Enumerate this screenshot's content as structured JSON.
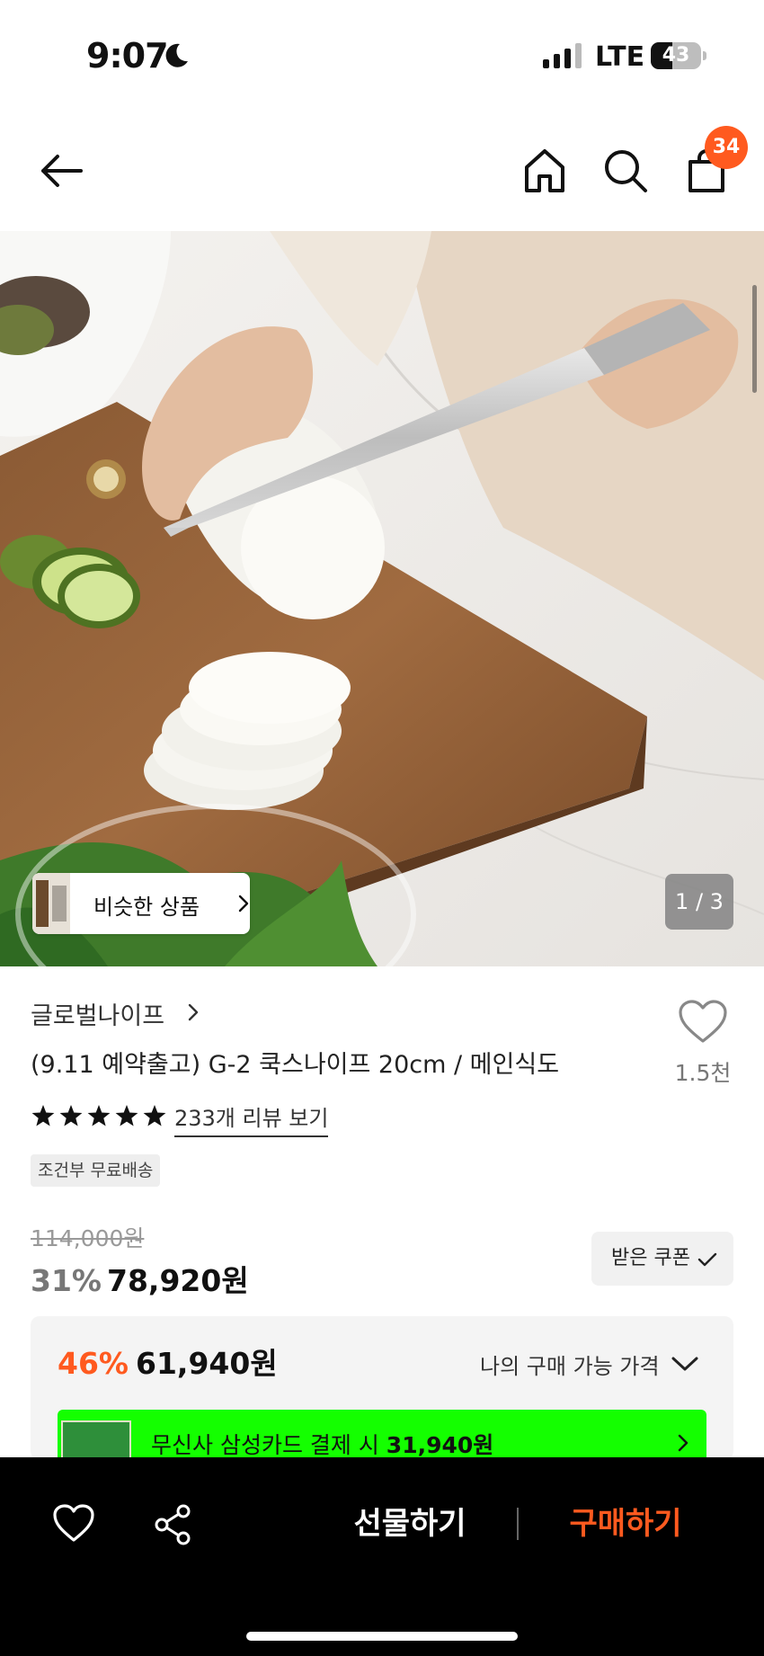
{
  "status_bar": {
    "time": "9:07",
    "network": "LTE",
    "battery": "43",
    "battery_level": 0.43
  },
  "nav": {
    "cart_count": "34"
  },
  "gallery": {
    "similar_label": "비슷한 상품",
    "page_indicator": "1 / 3"
  },
  "product": {
    "brand": "글로벌나이프",
    "title": "(9.11 예약출고) G-2 쿡스나이프 20cm / 메인식도",
    "like_count": "1.5천",
    "rating_stars": 5,
    "review_link": "233개 리뷰 보기",
    "shipping_badge": "조건부 무료배송"
  },
  "pricing": {
    "original_price": "114,000원",
    "discount_pct": "31%",
    "sale_price": "78,920원",
    "coupon_label": "받은 쿠폰",
    "my_pct": "46%",
    "my_price": "61,940원",
    "my_price_label": "나의 구매 가능 가격",
    "card_text_prefix": "무신사 삼성카드 결제 시 ",
    "card_price": "31,940원"
  },
  "bottom_bar": {
    "gift_label": "선물하기",
    "buy_label": "구매하기"
  },
  "colors": {
    "accent": "#ff5a1f",
    "card_banner": "#14ff00",
    "bar_bg": "#000000"
  }
}
